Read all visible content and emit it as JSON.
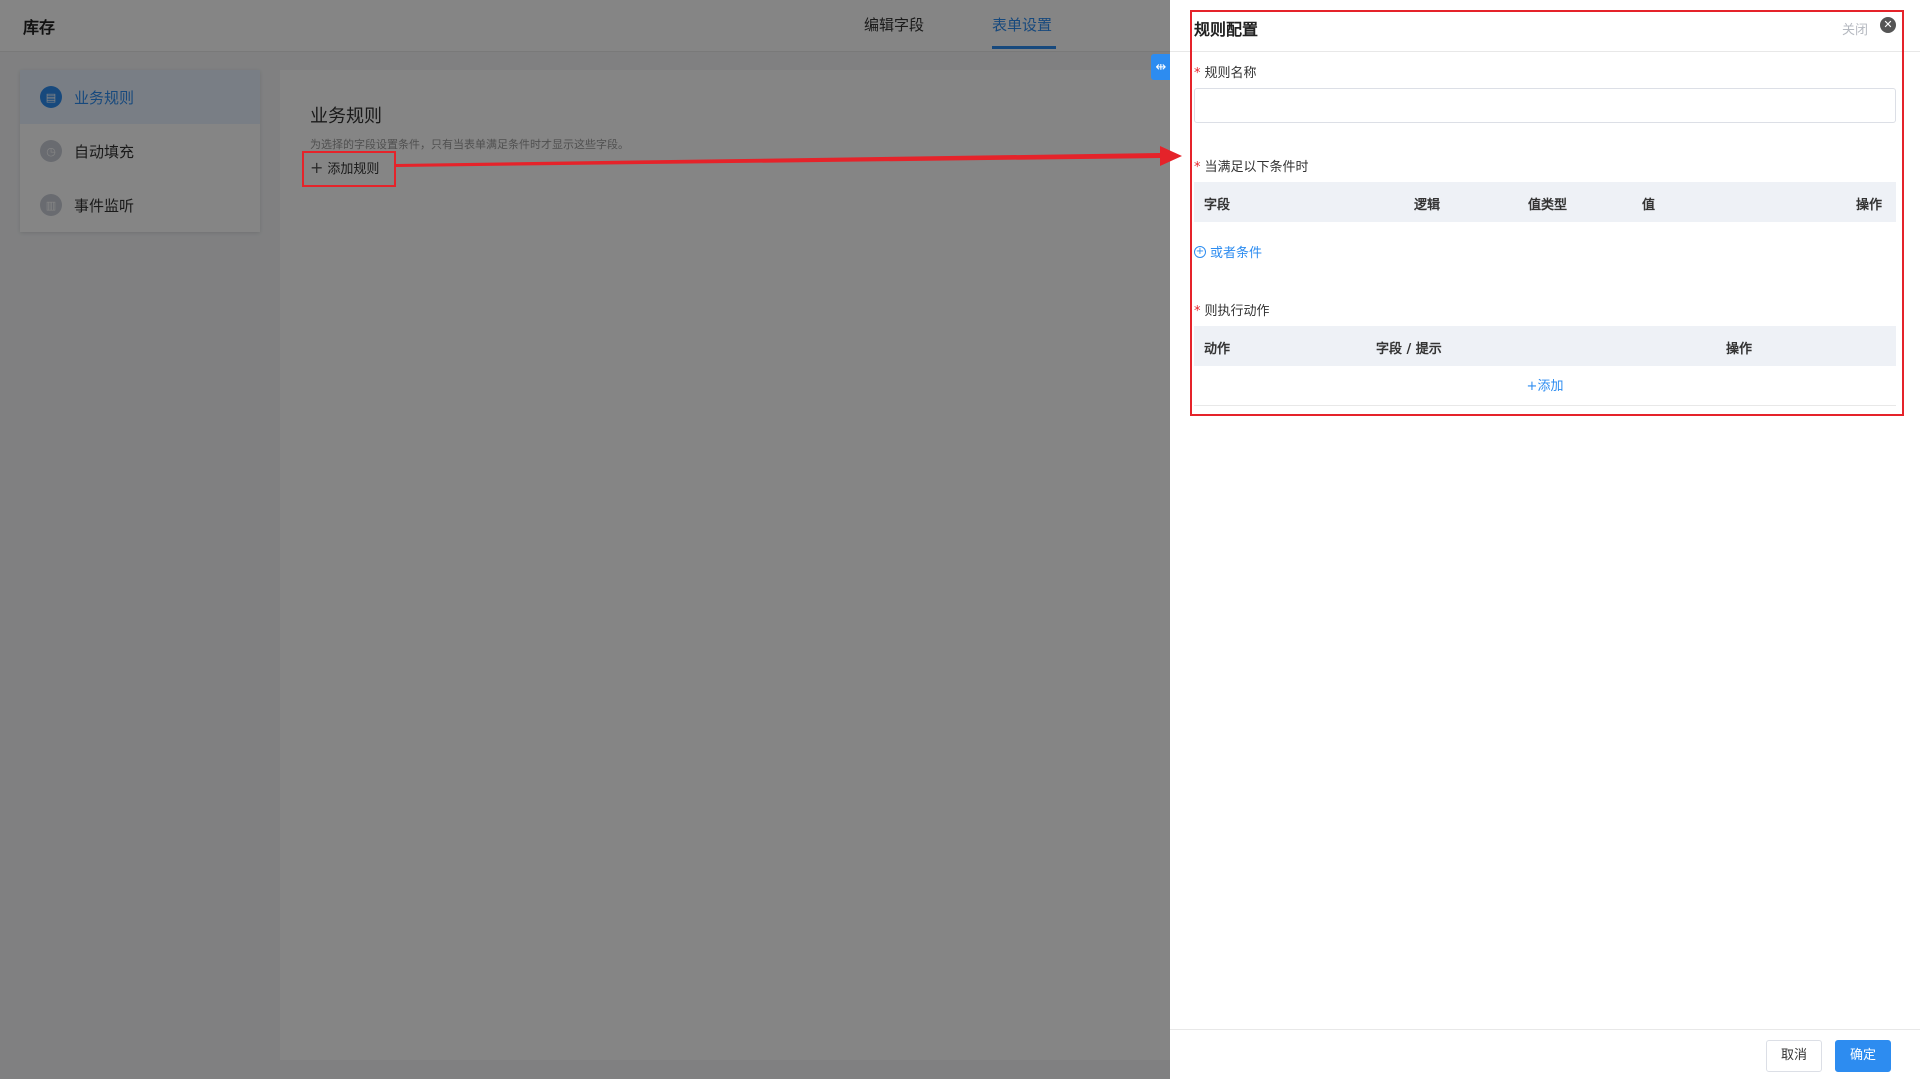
{
  "app": {
    "title": "库存"
  },
  "tabs": [
    {
      "label": "编辑字段"
    },
    {
      "label": "表单设置"
    }
  ],
  "sidebar": {
    "items": [
      {
        "label": "业务规则",
        "icon": "rule-icon"
      },
      {
        "label": "自动填充",
        "icon": "autofill-icon"
      },
      {
        "label": "事件监听",
        "icon": "event-icon"
      }
    ]
  },
  "content": {
    "title": "业务规则",
    "description": "为选择的字段设置条件，只有当表单满足条件时才显示这些字段。",
    "add_rule_label": "添加规则"
  },
  "drawer": {
    "title": "规则配置",
    "close_label": "关闭",
    "rule_name_label": "规则名称",
    "rule_name_value": "",
    "condition_label": "当满足以下条件时",
    "condition_columns": [
      "字段",
      "逻辑",
      "值类型",
      "值",
      "操作"
    ],
    "or_condition_label": "或者条件",
    "action_label": "则执行动作",
    "action_columns": [
      "动作",
      "字段 / 提示",
      "操作"
    ],
    "add_label": "+添加",
    "cancel_label": "取消",
    "ok_label": "确定"
  },
  "colors": {
    "accent": "#2d8cf0",
    "annotation": "#e5232a"
  }
}
